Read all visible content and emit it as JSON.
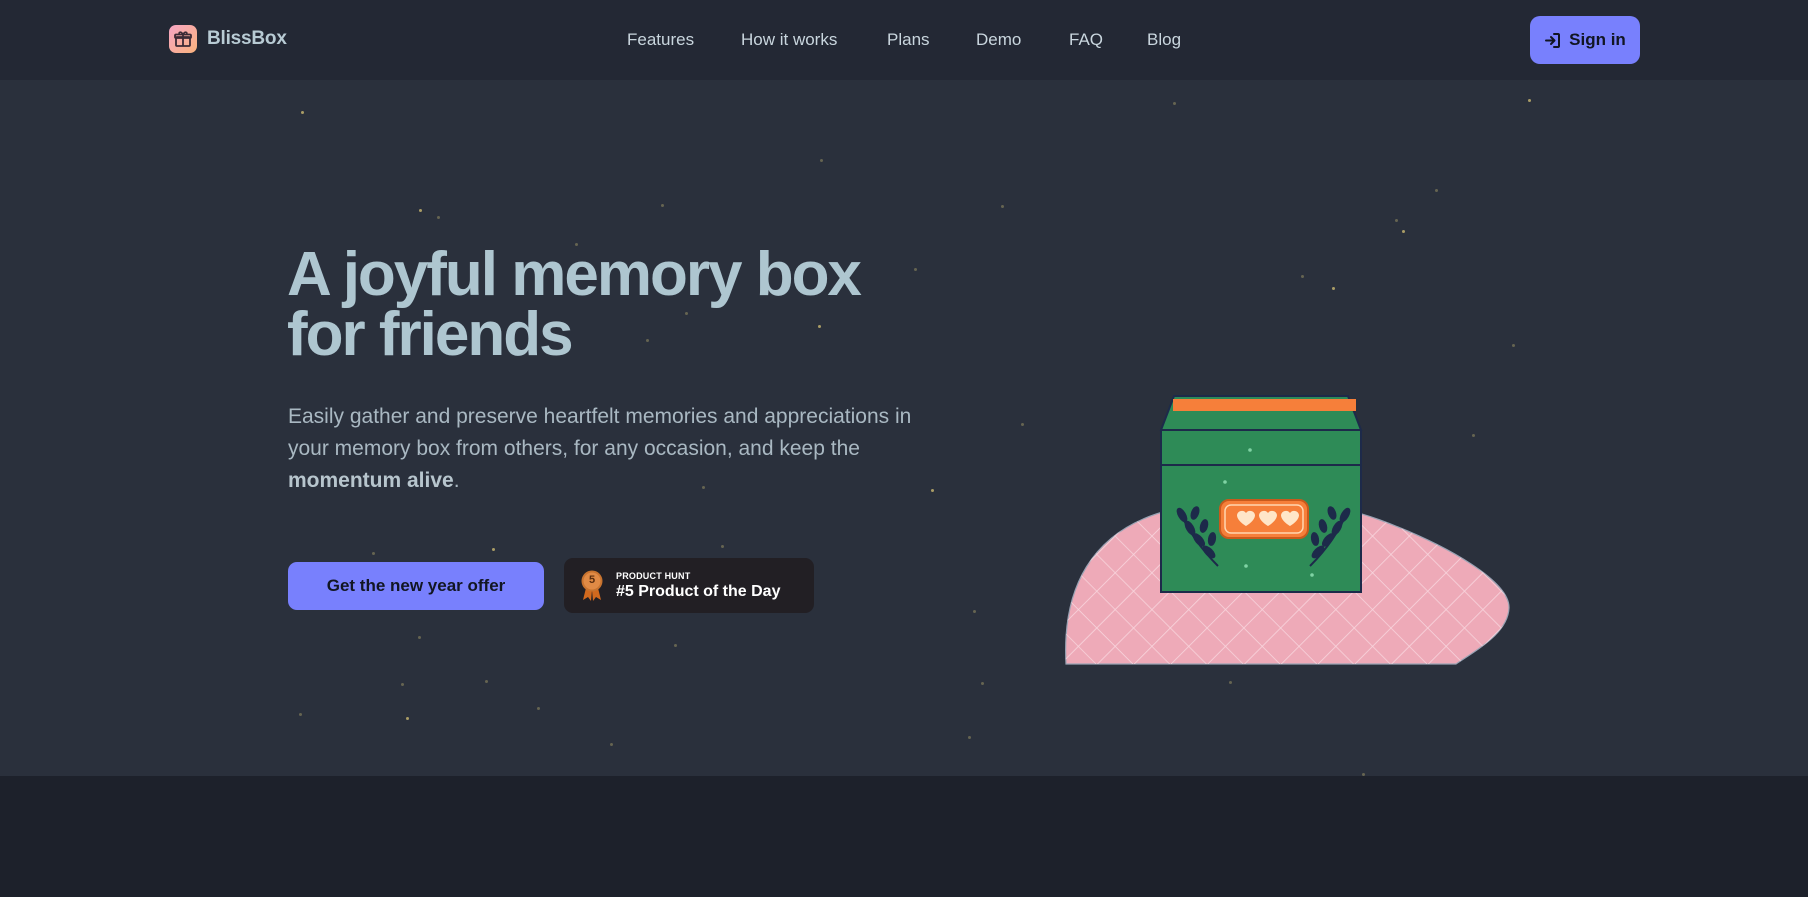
{
  "brand": {
    "name": "BlissBox",
    "logo_icon": "gift-icon"
  },
  "nav": {
    "links": [
      "Features",
      "How it works",
      "Plans",
      "Demo",
      "FAQ",
      "Blog"
    ],
    "signin_label": "Sign in",
    "signin_icon": "sign-in-icon"
  },
  "hero": {
    "headline_line1": "A joyful memory box",
    "headline_line2": "for friends",
    "sub_part1": "Easily gather and preserve heartfelt memories and appreciations in your memory box from others, for any occasion, and keep the ",
    "sub_bold": "momentum alive",
    "sub_end": ".",
    "cta_label": "Get the new year offer",
    "badge": {
      "small_label": "PRODUCT HUNT",
      "title": "#5 Product of the Day",
      "medal_number": "5"
    }
  },
  "colors": {
    "accent": "#7880fd",
    "box_green": "#2e8b57",
    "box_orange": "#f67f3a",
    "blob_pink": "#eeaab8"
  }
}
